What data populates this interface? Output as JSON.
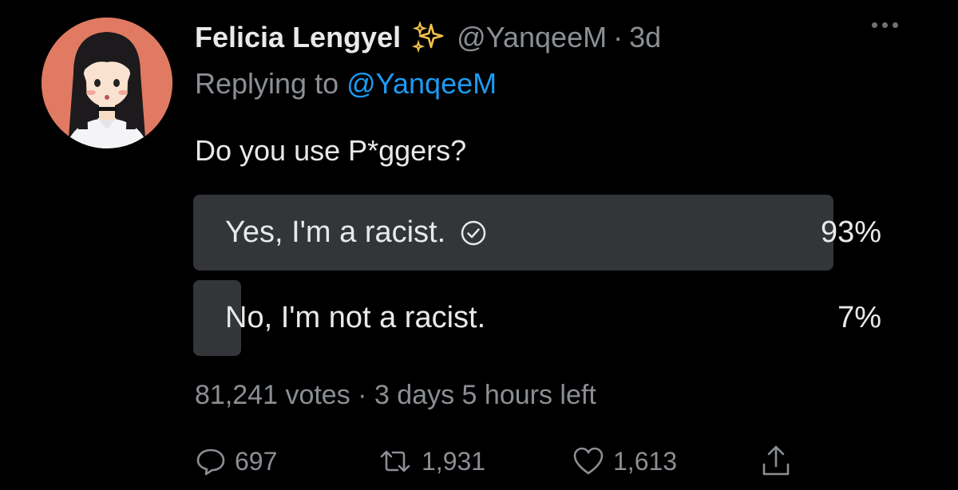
{
  "tweet": {
    "author_name": "Felicia Lengyel",
    "author_emoji": "sparkles-icon",
    "handle": "@YanqeeM",
    "separator": "·",
    "time": "3d",
    "replying_prefix": "Replying to",
    "replying_to": "@YanqeeM",
    "text": "Do you use P*ggers?"
  },
  "poll": {
    "options": [
      {
        "label": "Yes, I'm a racist.",
        "percent": "93%",
        "fraction": 0.93,
        "selected": true
      },
      {
        "label": "No, I'm not a racist.",
        "percent": "7%",
        "fraction": 0.07,
        "selected": false
      }
    ],
    "votes": "81,241 votes",
    "separator": "·",
    "time_left": "3 days 5 hours left"
  },
  "actions": {
    "replies": "697",
    "retweets": "1,931",
    "likes": "1,613"
  },
  "colors": {
    "background": "#000000",
    "text": "#e7e9ea",
    "muted": "#8b8f94",
    "link": "#1d9bf0",
    "poll_bar": "#333538",
    "avatar_bg": "#e07a62"
  }
}
